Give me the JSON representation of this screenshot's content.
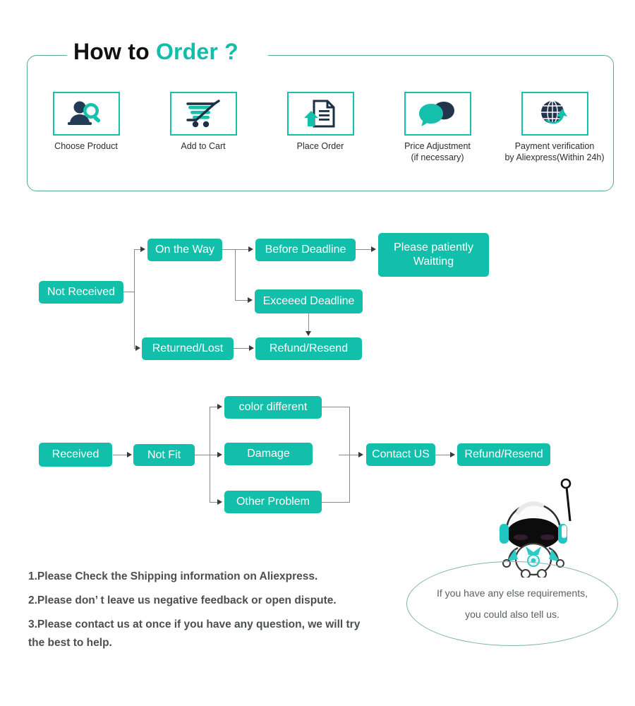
{
  "header": {
    "title_part1": "How to ",
    "title_part2": "Order ?",
    "accent_color": "#12BDAA",
    "frame_color": "#5aa89e"
  },
  "steps": [
    {
      "icon": "person-search-icon",
      "label_line1": "Choose  Product",
      "label_line2": ""
    },
    {
      "icon": "shopping-cart-icon",
      "label_line1": "Add to Cart",
      "label_line2": ""
    },
    {
      "icon": "document-upload-icon",
      "label_line1": "Place  Order",
      "label_line2": ""
    },
    {
      "icon": "speech-bubbles-icon",
      "label_line1": "Price Adjustment",
      "label_line2": "(if necessary)"
    },
    {
      "icon": "globe-arrow-icon",
      "label_line1": "Payment verification",
      "label_line2": "by Aliexpress(Within 24h)"
    }
  ],
  "flow_not_received": {
    "box_color": "#12BFAB",
    "line_color": "#8a8a8a",
    "nodes": {
      "start": "Not Received",
      "on_the_way": "On the Way",
      "returned_lost": "Returned/Lost",
      "before_deadline": "Before Deadline",
      "exceed_deadline": "Exceeed Deadline",
      "patient_line1": "Please patiently",
      "patient_line2": "Waitting",
      "refund_resend": "Refund/Resend"
    }
  },
  "flow_received": {
    "nodes": {
      "start": "Received",
      "not_fit": "Not Fit",
      "color_different": "color different",
      "damage": "Damage",
      "other_problem": "Other Problem",
      "contact_us": "Contact US",
      "refund_resend": "Refund/Resend"
    }
  },
  "notes": [
    "1.Please Check the Shipping information on Aliexpress.",
    "2.Please don’ t leave us negative feedback or open dispute.",
    "3.Please contact us at once if you have any question, we will try",
    " the best to help."
  ],
  "bubble": {
    "line1": "If you have any else requirements,",
    "line2": "you could also tell us."
  },
  "mascot": {
    "name": "astronaut-mascot"
  }
}
